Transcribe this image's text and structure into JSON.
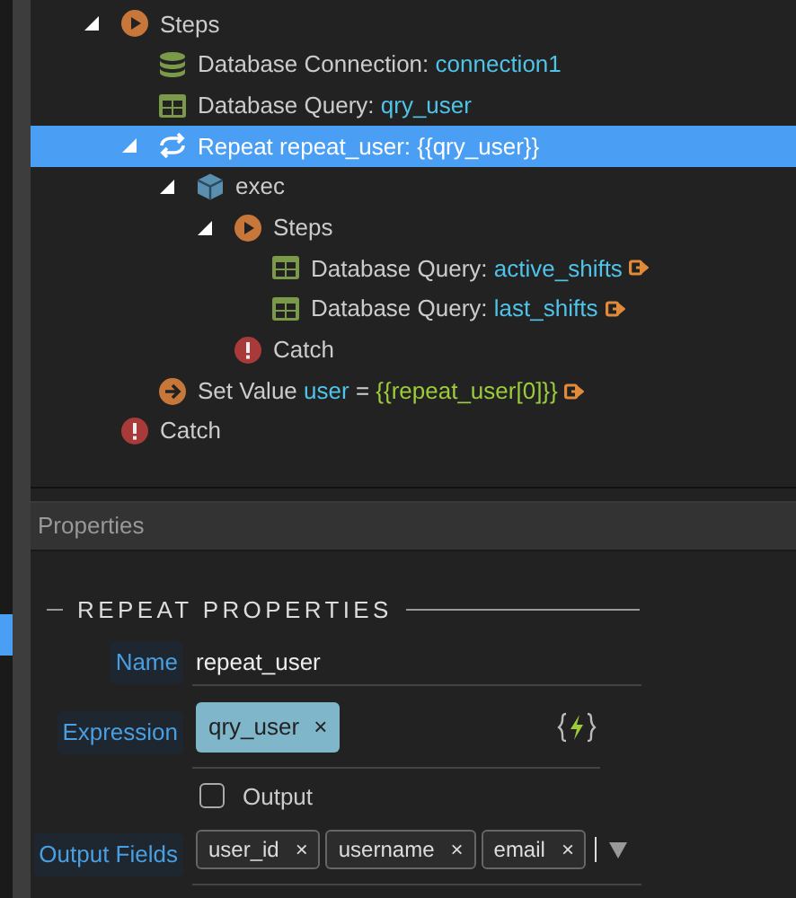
{
  "tree": [
    {
      "kind": "steps",
      "parts": [
        {
          "kind": "plain",
          "text": "Steps"
        }
      ],
      "expanded": true,
      "selected": false,
      "output": false,
      "children": [
        {
          "kind": "db-connection",
          "parts": [
            {
              "kind": "plain",
              "text": "Database Connection:"
            },
            {
              "kind": "var",
              "text": "connection1"
            }
          ],
          "selected": false,
          "output": false
        },
        {
          "kind": "db-query",
          "parts": [
            {
              "kind": "plain",
              "text": "Database Query:"
            },
            {
              "kind": "var",
              "text": "qry_user"
            }
          ],
          "selected": false,
          "output": false
        },
        {
          "kind": "repeat",
          "parts": [
            {
              "kind": "plain",
              "text": "Repeat repeat_user: {{qry_user}}"
            }
          ],
          "expanded": true,
          "selected": true,
          "output": false,
          "children": [
            {
              "kind": "exec",
              "parts": [
                {
                  "kind": "plain",
                  "text": "exec"
                }
              ],
              "expanded": true,
              "selected": false,
              "output": false,
              "children": [
                {
                  "kind": "steps",
                  "parts": [
                    {
                      "kind": "plain",
                      "text": "Steps"
                    }
                  ],
                  "expanded": true,
                  "selected": false,
                  "output": false,
                  "children": [
                    {
                      "kind": "db-query",
                      "parts": [
                        {
                          "kind": "plain",
                          "text": "Database Query:"
                        },
                        {
                          "kind": "var",
                          "text": "active_shifts"
                        }
                      ],
                      "selected": false,
                      "output": true
                    },
                    {
                      "kind": "db-query",
                      "parts": [
                        {
                          "kind": "plain",
                          "text": "Database Query:"
                        },
                        {
                          "kind": "var",
                          "text": "last_shifts"
                        }
                      ],
                      "selected": false,
                      "output": true
                    }
                  ]
                },
                {
                  "kind": "catch",
                  "parts": [
                    {
                      "kind": "plain",
                      "text": "Catch"
                    }
                  ],
                  "selected": false,
                  "output": false
                }
              ]
            }
          ]
        },
        {
          "kind": "set-value",
          "parts": [
            {
              "kind": "plain",
              "text": "Set Value"
            },
            {
              "kind": "var",
              "text": "user"
            },
            {
              "kind": "plain",
              "text": "="
            },
            {
              "kind": "expr",
              "text": "{{repeat_user[0]}}"
            }
          ],
          "selected": false,
          "output": true
        }
      ]
    },
    {
      "kind": "catch",
      "parts": [
        {
          "kind": "plain",
          "text": "Catch"
        }
      ],
      "selected": false,
      "output": false
    }
  ],
  "properties": {
    "title": "Properties",
    "section": "REPEAT PROPERTIES",
    "fields": [
      {
        "kind": "text",
        "label": "Name",
        "value": "repeat_user"
      },
      {
        "kind": "tags",
        "label": "Expression",
        "tags": [
          {
            "text": "qry_user",
            "remove": "×"
          }
        ]
      },
      {
        "kind": "checkbox",
        "label": "Output",
        "checked": false
      },
      {
        "kind": "multiselect",
        "label": "Output Fields",
        "tags": [
          {
            "text": "user_id",
            "remove": "×"
          },
          {
            "text": "username",
            "remove": "×"
          },
          {
            "text": "email",
            "remove": "×"
          }
        ]
      }
    ]
  }
}
